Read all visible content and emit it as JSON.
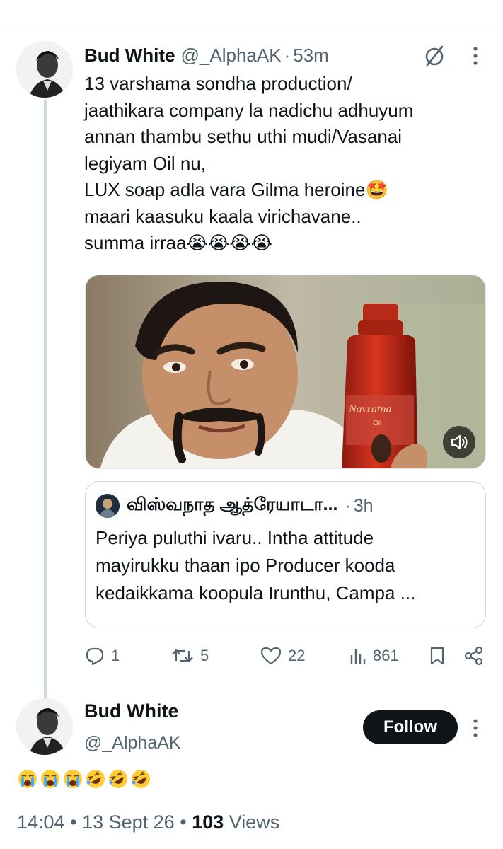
{
  "tweet": {
    "author_name": "Bud White",
    "author_handle": "@_AlphaAK",
    "separator": "·",
    "time_ago": "53m",
    "text": "13 varshama sondha production/\njaathikara company la nadichu adhuyum\nannan thambu sethu uthi mudi/Vasanai\nlegiyam Oil nu,\nLUX soap adla vara  Gilma heroine🤩\nmaari kaasuku  kaala virichavane..\nsumma irraa😭😭😭😭",
    "media": {
      "bottle_label": "Navratna",
      "bottle_sub": "Oil"
    },
    "quote": {
      "author_name": "விஸ்வநாத ஆத்ரேயாடா...",
      "separator": "·",
      "time_ago": "3h",
      "text": "Periya puluthi ivaru.. Intha attitude\nmayirukku thaan ipo Producer kooda\nkedaikkama koopula Irunthu, Campa ..."
    },
    "actions": {
      "replies": "1",
      "reposts": "5",
      "likes": "22",
      "views": "861"
    }
  },
  "reply": {
    "author_name": "Bud White",
    "author_handle": "@_AlphaAK",
    "follow_label": "Follow",
    "emojis": [
      "loudly-crying",
      "loudly-crying",
      "loudly-crying",
      "rofl",
      "rofl",
      "rofl"
    ],
    "time": "14:04",
    "date": "13 Sept 26",
    "views_count": "103",
    "views_label": "Views",
    "bullet": "•"
  },
  "colors": {
    "text": "#0f1419",
    "secondary": "#536471",
    "border": "#cfd9de",
    "follow_bg": "#0f1419",
    "emoji_yellow": "#ffcc33",
    "tears_blue": "#4aa8ff"
  }
}
